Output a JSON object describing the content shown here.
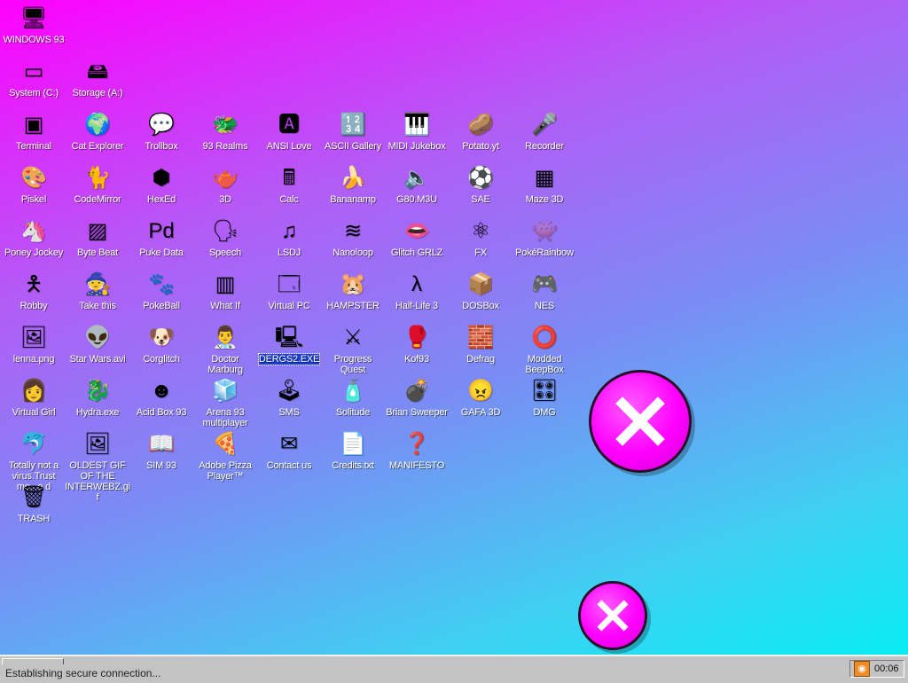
{
  "desktop_icons": [
    {
      "label": "WINDOWS 93",
      "icon": "computer-icon",
      "glyph": "🖥"
    },
    {
      "label": "System (C:)",
      "icon": "drive-icon",
      "glyph": "▭"
    },
    {
      "label": "Storage (A:)",
      "icon": "floppy-drive-icon",
      "glyph": "🖴"
    },
    {
      "label": "Terminal",
      "icon": "terminal-icon",
      "glyph": "▣"
    },
    {
      "label": "Cat Explorer",
      "icon": "globe-cat-icon",
      "glyph": "🌍"
    },
    {
      "label": "Trollbox",
      "icon": "chat-bubble-icon",
      "glyph": "💬"
    },
    {
      "label": "93 Realms",
      "icon": "realms-icon",
      "glyph": "🐲"
    },
    {
      "label": "ANSI Love",
      "icon": "ansi-letter-icon",
      "glyph": "🅰"
    },
    {
      "label": "ASCII Gallery",
      "icon": "ascii-numbers-icon",
      "glyph": "🔢"
    },
    {
      "label": "MIDI Jukebox",
      "icon": "piano-keys-icon",
      "glyph": "🎹"
    },
    {
      "label": "Potato.yt",
      "icon": "potato-icon",
      "glyph": "🥔"
    },
    {
      "label": "Recorder",
      "icon": "microphone-icon",
      "glyph": "🎤"
    },
    {
      "label": "Piskel",
      "icon": "paint-palette-icon",
      "glyph": "🎨"
    },
    {
      "label": "CodeMirror",
      "icon": "codemirror-icon",
      "glyph": "🐈"
    },
    {
      "label": "HexEd",
      "icon": "hex-cube-icon",
      "glyph": "⬢"
    },
    {
      "label": "3D",
      "icon": "teapot-icon",
      "glyph": "🫖"
    },
    {
      "label": "Calc",
      "icon": "calculator-icon",
      "glyph": "🖩"
    },
    {
      "label": "Bananamp",
      "icon": "banana-icon",
      "glyph": "🍌"
    },
    {
      "label": "G80.M3U",
      "icon": "audio-file-icon",
      "glyph": "🔈"
    },
    {
      "label": "SAE",
      "icon": "amiga-ball-icon",
      "glyph": "⚽"
    },
    {
      "label": "Maze 3D",
      "icon": "maze-icon",
      "glyph": "▦"
    },
    {
      "label": "Poney Jockey",
      "icon": "pony-icon",
      "glyph": "🦄"
    },
    {
      "label": "Byte Beat",
      "icon": "bytebeat-icon",
      "glyph": "▨"
    },
    {
      "label": "Puke Data",
      "icon": "puredata-icon",
      "glyph": "Pd"
    },
    {
      "label": "Speech",
      "icon": "speech-face-icon",
      "glyph": "🗣"
    },
    {
      "label": "LSDJ",
      "icon": "lsdj-icon",
      "glyph": "♫"
    },
    {
      "label": "Nanoloop",
      "icon": "wave-icon",
      "glyph": "≋"
    },
    {
      "label": "Glitch GRLZ",
      "icon": "lips-icon",
      "glyph": "👄"
    },
    {
      "label": "FX",
      "icon": "atom-icon",
      "glyph": "⚛"
    },
    {
      "label": "PokéRainbow",
      "icon": "pokerainbow-icon",
      "glyph": "👾"
    },
    {
      "label": "Robby",
      "icon": "stick-figure-icon",
      "glyph": "🯅"
    },
    {
      "label": "Take this",
      "icon": "pixel-guy-icon",
      "glyph": "🧙"
    },
    {
      "label": "PokeBall",
      "icon": "pokemon-icon",
      "glyph": "🐾"
    },
    {
      "label": "What If",
      "icon": "what-if-icon",
      "glyph": "▥"
    },
    {
      "label": "Virtual PC",
      "icon": "virtual-pc-icon",
      "glyph": "🗔"
    },
    {
      "label": "HAMPSTER",
      "icon": "hamster-icon",
      "glyph": "🐹"
    },
    {
      "label": "Half-Life 3",
      "icon": "lambda-icon",
      "glyph": "λ"
    },
    {
      "label": "DOSBox",
      "icon": "dosbox-icon",
      "glyph": "📦"
    },
    {
      "label": "NES",
      "icon": "nes-console-icon",
      "glyph": "🎮"
    },
    {
      "label": "lenna.png",
      "icon": "image-file-icon",
      "glyph": "🖼"
    },
    {
      "label": "Star Wars.avi",
      "icon": "yoda-icon",
      "glyph": "👽"
    },
    {
      "label": "Corglitch",
      "icon": "corgi-icon",
      "glyph": "🐶"
    },
    {
      "label": "Doctor Marburg",
      "icon": "doctor-icon",
      "glyph": "👨‍⚕️"
    },
    {
      "label": "DERGS2.EXE",
      "icon": "dergs-exe-icon",
      "glyph": "🖳"
    },
    {
      "label": "Progress Quest",
      "icon": "crossed-swords-icon",
      "glyph": "⚔"
    },
    {
      "label": "Kof93",
      "icon": "fighter-icon",
      "glyph": "🥊"
    },
    {
      "label": "Defrag",
      "icon": "defrag-icon",
      "glyph": "🧱"
    },
    {
      "label": "Modded BeepBox",
      "icon": "green-ring-icon",
      "glyph": "⭕"
    },
    {
      "label": "Virtual Girl",
      "icon": "girl-face-icon",
      "glyph": "👩"
    },
    {
      "label": "Hydra.exe",
      "icon": "dragon-icon",
      "glyph": "🐉"
    },
    {
      "label": "Acid Box 93",
      "icon": "smiley-icon",
      "glyph": "☻"
    },
    {
      "label": "Arena 93 multiplayer",
      "icon": "cube-icon",
      "glyph": "🧊"
    },
    {
      "label": "SMS",
      "icon": "console-icon",
      "glyph": "🕹"
    },
    {
      "label": "Solitude",
      "icon": "bottle-icon",
      "glyph": "🧴"
    },
    {
      "label": "Brian Sweeper",
      "icon": "mine-icon",
      "glyph": "💣"
    },
    {
      "label": "GAFA 3D",
      "icon": "doom-face-icon",
      "glyph": "😠"
    },
    {
      "label": "DMG",
      "icon": "gameboy-icon",
      "glyph": "🎛"
    },
    {
      "label": "Totally not a virus.Trust me...a d",
      "icon": "dolphin-shortcut-icon",
      "glyph": "🐬"
    },
    {
      "label": "OLDEST GIF OF THE INTERWEBZ.gif",
      "icon": "gif-file-icon",
      "glyph": "🖼"
    },
    {
      "label": "SIM 93",
      "icon": "book-icon",
      "glyph": "📖"
    },
    {
      "label": "Adobe Pizza Player™",
      "icon": "pizza-icon",
      "glyph": "🍕"
    },
    {
      "label": "Contact us",
      "icon": "letter-pen-icon",
      "glyph": "✉"
    },
    {
      "label": "Credits.txt",
      "icon": "text-file-icon",
      "glyph": "📄"
    },
    {
      "label": "MANIFESTO",
      "icon": "question-icon",
      "glyph": "❓"
    },
    {
      "label": "TRASH",
      "icon": "recycle-bin-icon",
      "glyph": "🗑"
    }
  ],
  "selected_icon": "DERGS2.EXE",
  "close_buttons": [
    "big-close-x",
    "small-close-x"
  ],
  "taskbar": {
    "status_text": "Establishing secure connection...",
    "clock": "00:06",
    "tray_icon": "rss-icon"
  },
  "colors": {
    "gradient_top_left": "#ff00ff",
    "gradient_bottom_right": "#00f0f4",
    "close_button_fill": "#ff00ff",
    "selection": "#1a3fd6",
    "taskbar": "#c3c3c3"
  }
}
